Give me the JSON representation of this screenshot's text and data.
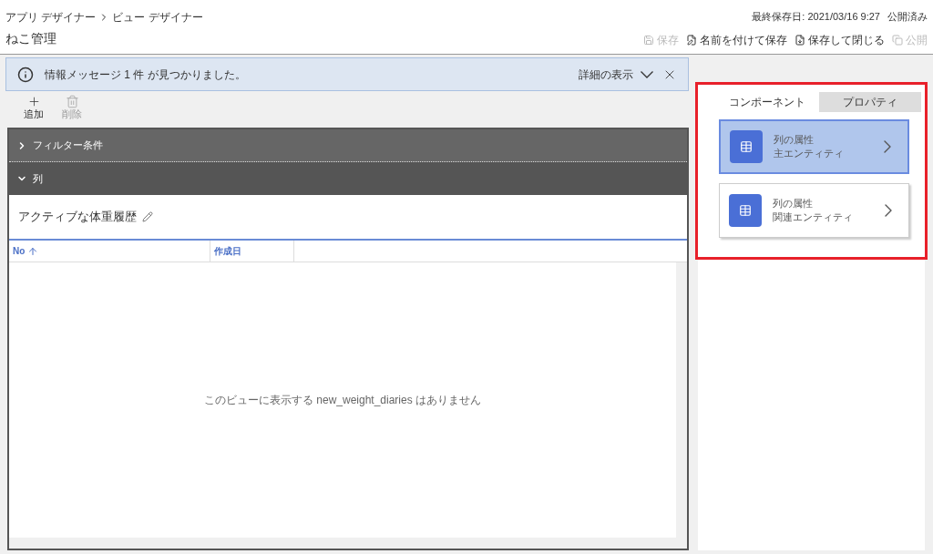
{
  "breadcrumb": [
    {
      "label": "アプリ デザイナー"
    },
    {
      "label": "ビュー デザイナー"
    }
  ],
  "title": "ねこ管理",
  "status": {
    "saved": "最終保存日: 2021/03/16 9:27",
    "published": "公開済み"
  },
  "commands": [
    {
      "label": "保存",
      "kind": "save",
      "disabled": true
    },
    {
      "label": "名前を付けて保存",
      "kind": "saveas",
      "disabled": false
    },
    {
      "label": "保存して閉じる",
      "kind": "saveclose",
      "disabled": false
    },
    {
      "label": "公開",
      "kind": "publish",
      "disabled": true
    }
  ],
  "notification": {
    "message": "情報メッセージ 1 件 が見つかりました。",
    "details": "詳細の表示"
  },
  "toolbar": [
    {
      "label": "追加",
      "kind": "add",
      "disabled": false
    },
    {
      "label": "削除",
      "kind": "delete",
      "disabled": true
    }
  ],
  "sections": [
    {
      "label": "フィルター条件",
      "expanded": false
    },
    {
      "label": "列",
      "expanded": true
    }
  ],
  "view": {
    "name": "アクティブな体重履歴",
    "columns": [
      {
        "label": "No",
        "sorted": true
      },
      {
        "label": "作成日",
        "sorted": false
      }
    ],
    "empty": "このビューに表示する new_weight_diaries はありません"
  },
  "tabs": [
    {
      "label": "コンポーネント",
      "selected": true
    },
    {
      "label": "プロパティ",
      "selected": false
    }
  ],
  "components": [
    {
      "line1": "列の属性",
      "line2": "主エンティティ",
      "selected": true
    },
    {
      "line1": "列の属性",
      "line2": "関連エンティティ",
      "selected": false
    }
  ]
}
